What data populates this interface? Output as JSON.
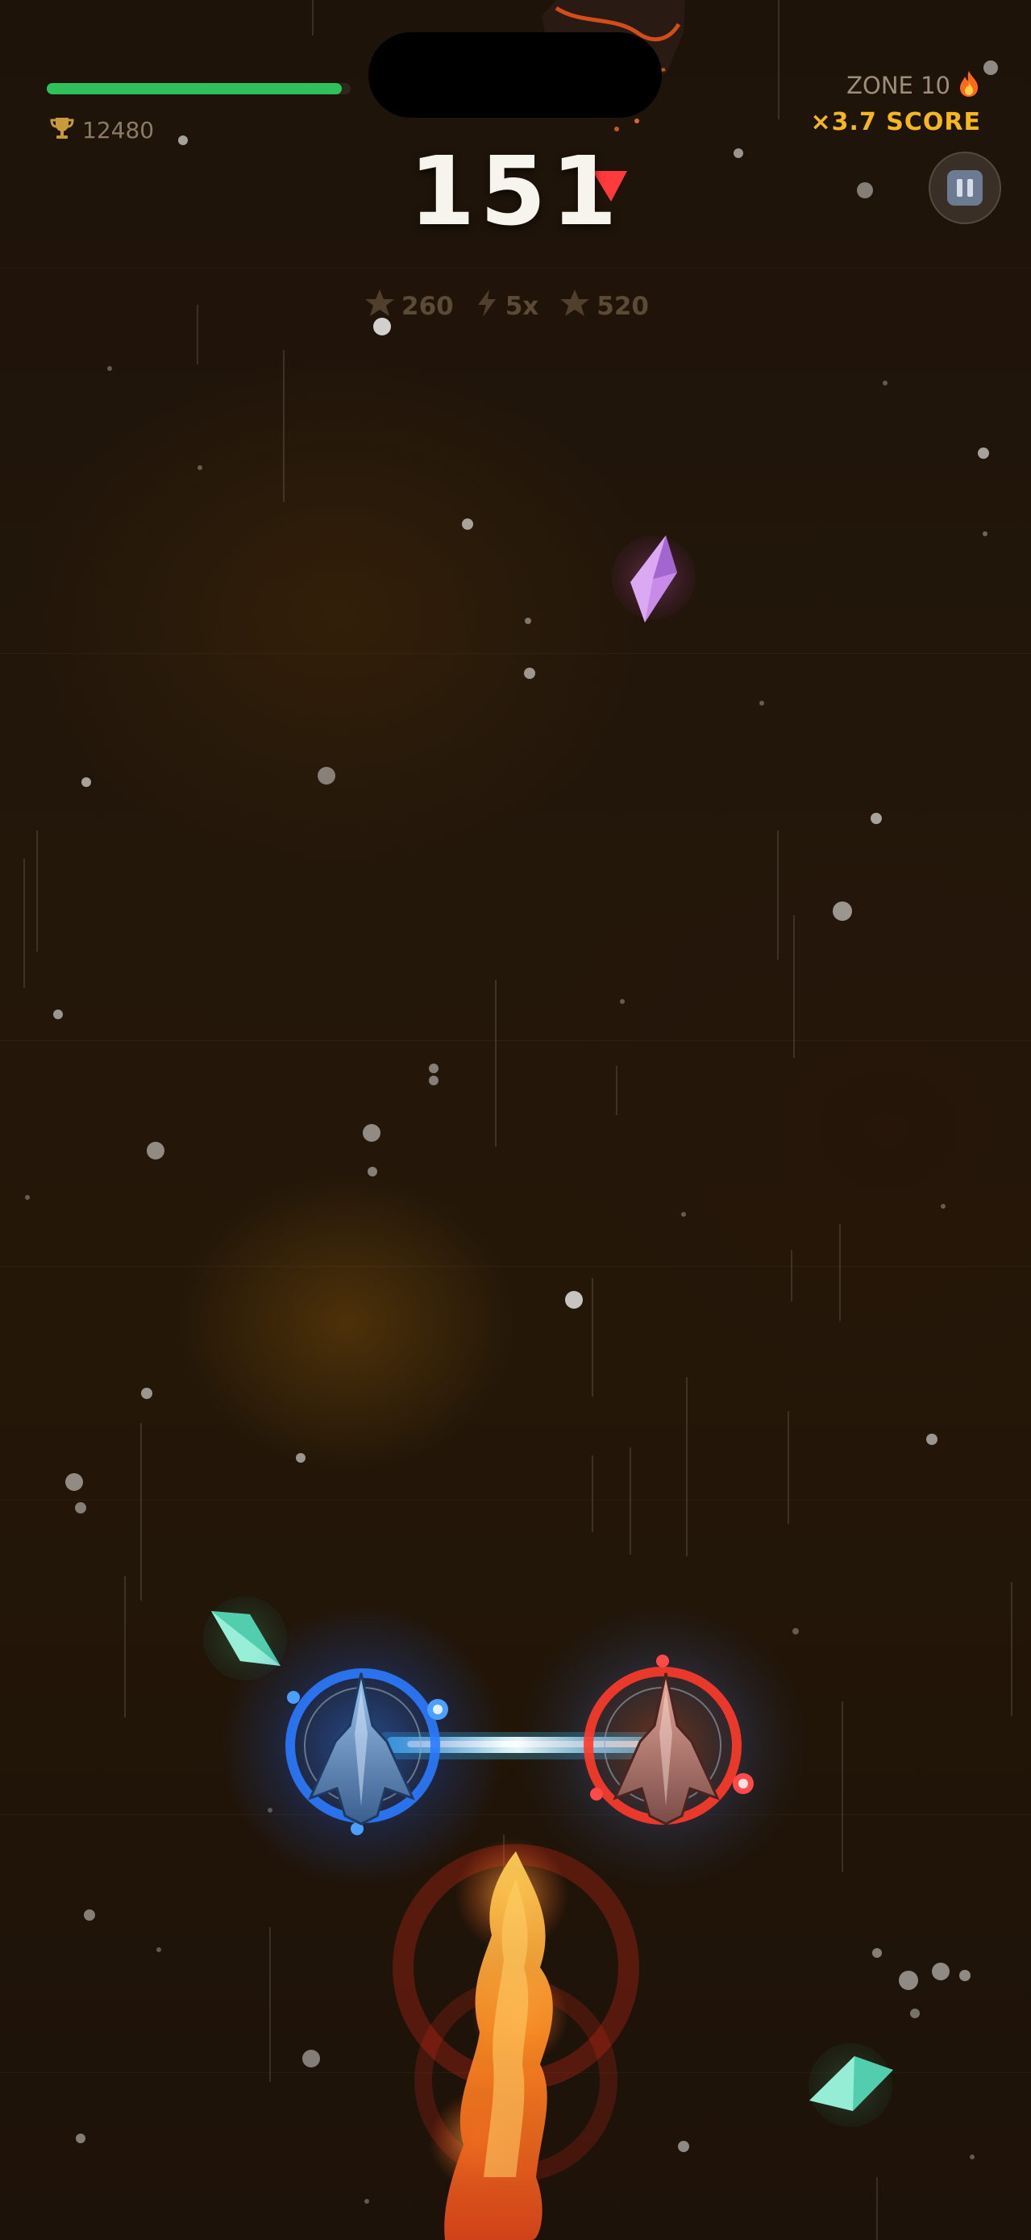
{
  "hud": {
    "health": 0.97,
    "best_score": "12480",
    "zone_label": "ZONE 10",
    "multiplier_label": "×3.7 SCORE",
    "score": "151",
    "stats": [
      {
        "icon": "star-icon",
        "value": "260"
      },
      {
        "icon": "lightning-icon",
        "value": "5x"
      },
      {
        "icon": "star-icon",
        "value": "520"
      }
    ]
  },
  "icons": {
    "best": "trophy-icon",
    "zone": "flame-icon",
    "pause": "pause-icon"
  },
  "colors": {
    "health": "#2fc25a",
    "multiplier": "#f5b621",
    "ship_left_glow": "#2b7bff",
    "ship_right_glow": "#ff3b2b",
    "tether": "#7ee0ee",
    "gem_purple": "#c98be8",
    "gem_teal": "#6fe3c6",
    "fire": "#ff7a1a"
  }
}
